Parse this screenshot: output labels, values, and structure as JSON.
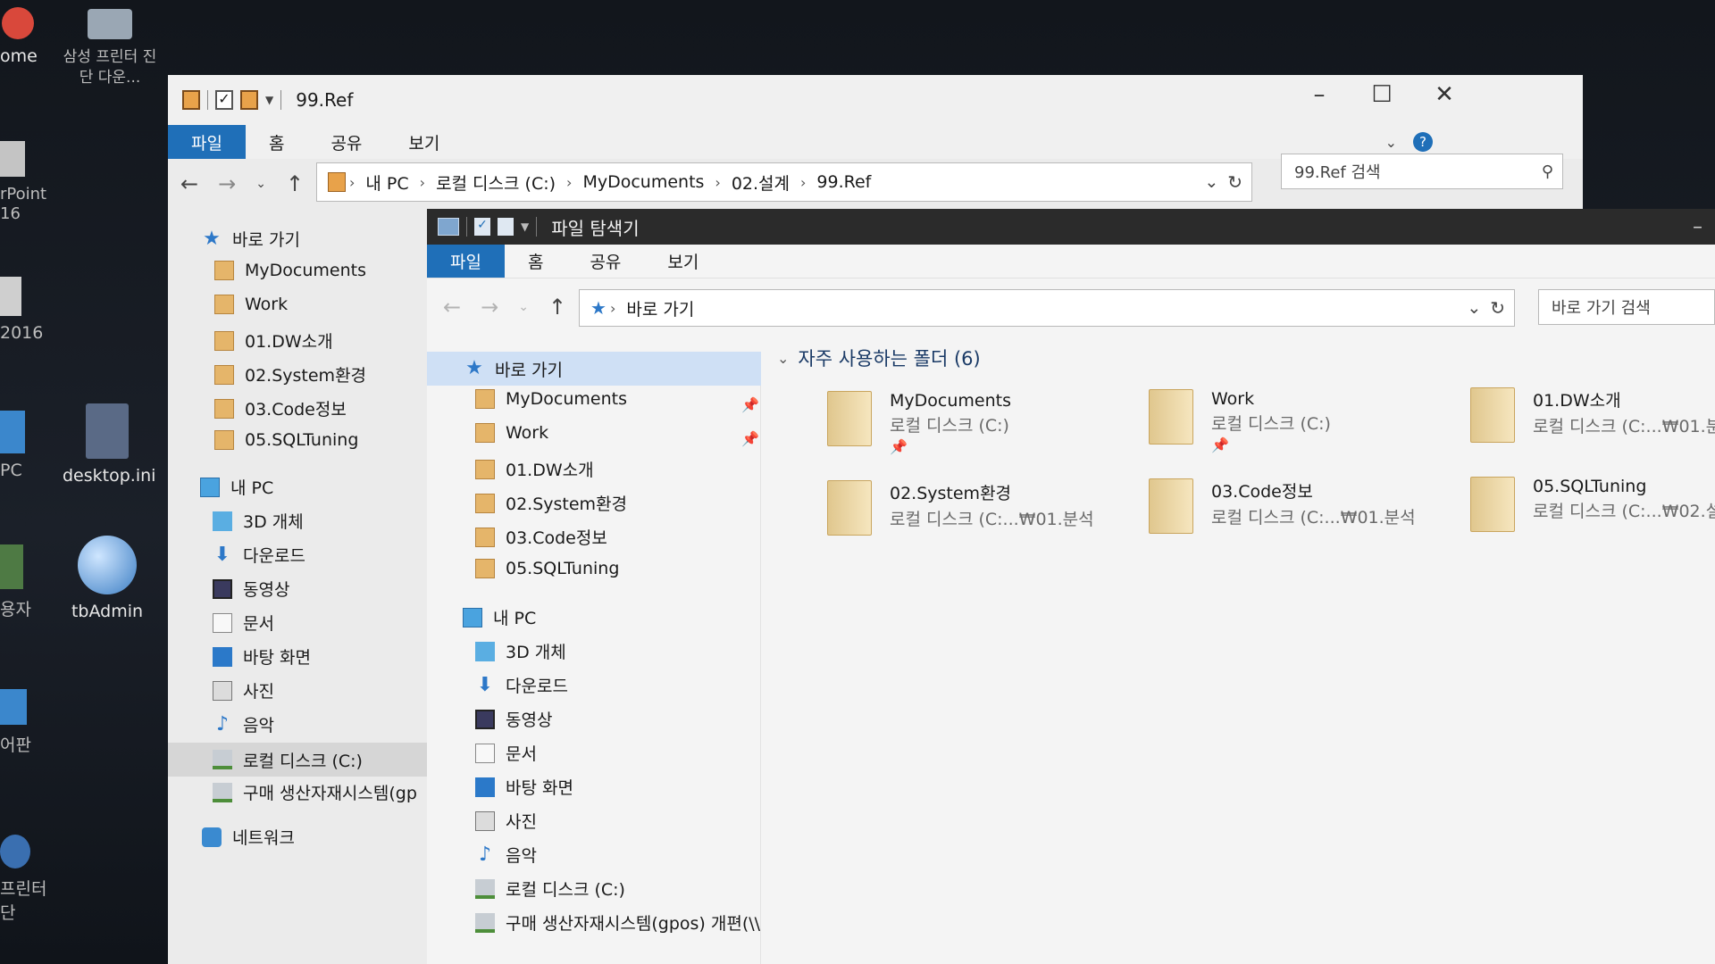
{
  "desktop": {
    "icons": [
      {
        "label": "ome"
      },
      {
        "label": "삼성 프린터 진단 다운..."
      },
      {
        "label": "rPoint 16"
      },
      {
        "label": "2016"
      },
      {
        "label": "PC"
      },
      {
        "label": "desktop.ini"
      },
      {
        "label": "용자"
      },
      {
        "label": "tbAdmin"
      },
      {
        "label": "어판"
      },
      {
        "label": "프린터 단"
      }
    ]
  },
  "back_window": {
    "title": "99.Ref",
    "ribbon_tabs": [
      "파일",
      "홈",
      "공유",
      "보기"
    ],
    "breadcrumb": [
      "내 PC",
      "로컬 디스크 (C:)",
      "MyDocuments",
      "02.설계",
      "99.Ref"
    ],
    "search_placeholder": "99.Ref 검색",
    "nav": {
      "quick_access": "바로 가기",
      "pinned": [
        "MyDocuments",
        "Work",
        "01.DW소개",
        "02.System환경",
        "03.Code정보",
        "05.SQLTuning"
      ],
      "this_pc": "내 PC",
      "pc_items": [
        "3D 개체",
        "다운로드",
        "동영상",
        "문서",
        "바탕 화면",
        "사진",
        "음악",
        "로컬 디스크 (C:)",
        "구매 생산자재시스템(gp"
      ],
      "network": "네트워크"
    }
  },
  "front_window": {
    "title": "파일 탐색기",
    "ribbon_tabs": [
      "파일",
      "홈",
      "공유",
      "보기"
    ],
    "breadcrumb": [
      "바로 가기"
    ],
    "search_placeholder": "바로 가기 검색",
    "nav": {
      "quick_access": "바로 가기",
      "pinned": [
        "MyDocuments",
        "Work",
        "01.DW소개",
        "02.System환경",
        "03.Code정보",
        "05.SQLTuning"
      ],
      "this_pc": "내 PC",
      "pc_items": [
        "3D 개체",
        "다운로드",
        "동영상",
        "문서",
        "바탕 화면",
        "사진",
        "음악",
        "로컬 디스크 (C:)",
        "구매 생산자재시스템(gpos) 개편(\\\\"
      ]
    },
    "section_header": "자주 사용하는 폴더 (6)",
    "frequent_folders": [
      {
        "name": "MyDocuments",
        "location": "로컬 디스크 (C:)",
        "pinned": true
      },
      {
        "name": "Work",
        "location": "로컬 디스크 (C:)",
        "pinned": true
      },
      {
        "name": "01.DW소개",
        "location": "로컬 디스크 (C:...₩01.분"
      },
      {
        "name": "02.System환경",
        "location": "로컬 디스크 (C:...₩01.분석"
      },
      {
        "name": "03.Code정보",
        "location": "로컬 디스크 (C:...₩01.분석"
      },
      {
        "name": "05.SQLTuning",
        "location": "로컬 디스크 (C:...₩02.설"
      }
    ]
  },
  "colors": {
    "file_tab": "#1f6fb8",
    "selection": "#cfe0f5",
    "accent_blue": "#2d78c8"
  }
}
